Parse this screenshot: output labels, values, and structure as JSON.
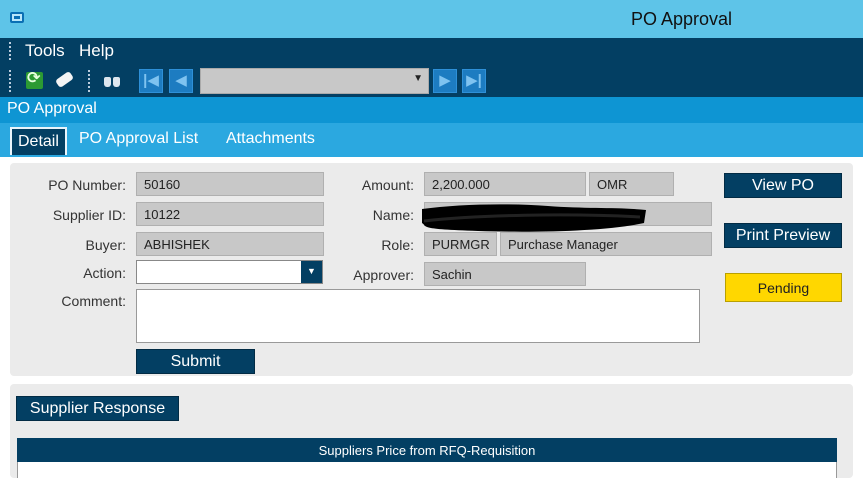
{
  "window": {
    "title": "PO Approval"
  },
  "menu": {
    "items": [
      "Tools",
      "Help"
    ]
  },
  "toolbar": {
    "icons": [
      "refresh-icon",
      "eraser-icon",
      "binoculars-icon"
    ],
    "nav": [
      "first-record",
      "previous-record",
      "next-record",
      "last-record"
    ],
    "record_select_value": ""
  },
  "section_title": "PO Approval",
  "tabs": [
    "Detail",
    "PO Approval List",
    "Attachments"
  ],
  "active_tab": "Detail",
  "form": {
    "po_number": {
      "label": "PO Number:",
      "value": "50160"
    },
    "supplier_id": {
      "label": "Supplier ID:",
      "value": "10122"
    },
    "buyer": {
      "label": "Buyer:",
      "value": "ABHISHEK"
    },
    "action": {
      "label": "Action:",
      "value": ""
    },
    "comment": {
      "label": "Comment:",
      "value": ""
    },
    "amount": {
      "label": "Amount:",
      "value": "2,200.000",
      "currency": "OMR"
    },
    "name": {
      "label": "Name:",
      "value": ""
    },
    "role": {
      "label": "Role:",
      "code": "PURMGR",
      "description": "Purchase Manager"
    },
    "approver": {
      "label": "Approver:",
      "value": "Sachin"
    }
  },
  "buttons": {
    "submit": "Submit",
    "view_po": "View PO",
    "print_preview": "Print Preview",
    "status": "Pending"
  },
  "supplier_section": {
    "button": "Supplier Response",
    "table_title": "Suppliers Price from RFQ-Requisition"
  },
  "colors": {
    "title_bar": "#5ec4e8",
    "dark_navy": "#033f63",
    "section_blue": "#0e95d3",
    "tab_blue": "#2ba8e0",
    "status_yellow": "#ffd700"
  }
}
